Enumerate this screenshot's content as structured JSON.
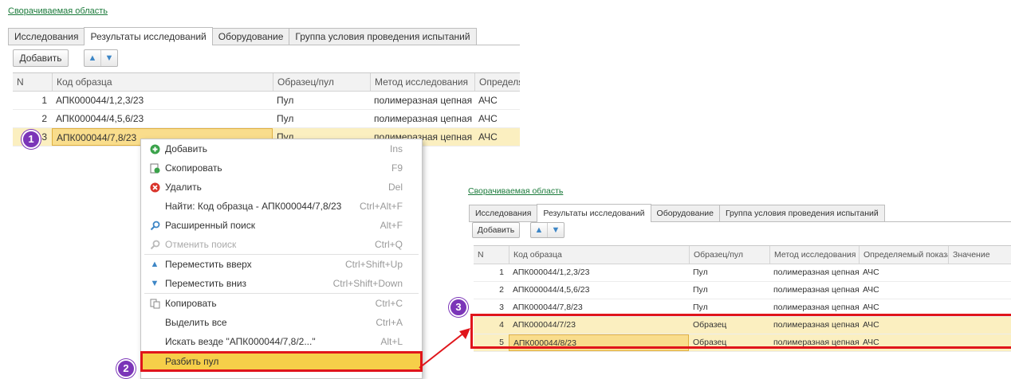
{
  "main": {
    "collapse_link": "Сворачиваемая область",
    "tabs": [
      "Исследования",
      "Результаты исследований",
      "Оборудование",
      "Группа условия проведения испытаний"
    ],
    "add_button": "Добавить",
    "columns": [
      "N",
      "Код образца",
      "Образец/пул",
      "Метод исследования",
      "Определяе"
    ],
    "rows": [
      {
        "n": "1",
        "code": "АПК000044/1,2,3/23",
        "type": "Пул",
        "method": "полимеразная цепная ...",
        "det": "АЧС"
      },
      {
        "n": "2",
        "code": "АПК000044/4,5,6/23",
        "type": "Пул",
        "method": "полимеразная цепная ...",
        "det": "АЧС"
      },
      {
        "n": "3",
        "code": "АПК000044/7,8/23",
        "type": "Пул",
        "method": "полимеразная цепная ...",
        "det": "АЧС"
      }
    ]
  },
  "context_menu": {
    "items": [
      {
        "label": "Добавить",
        "shortcut": "Ins",
        "icon": "add-icon"
      },
      {
        "label": "Скопировать",
        "shortcut": "F9",
        "icon": "copy-icon"
      },
      {
        "label": "Удалить",
        "shortcut": "Del",
        "icon": "delete-icon"
      },
      {
        "label": "Найти: Код образца - АПК000044/7,8/23",
        "shortcut": "Ctrl+Alt+F"
      },
      {
        "label": "Расширенный поиск",
        "shortcut": "Alt+F",
        "icon": "search-icon"
      },
      {
        "label": "Отменить поиск",
        "shortcut": "Ctrl+Q",
        "icon": "cancel-search-icon"
      },
      {
        "label": "Переместить вверх",
        "shortcut": "Ctrl+Shift+Up",
        "icon": "arrow-up-icon"
      },
      {
        "label": "Переместить вниз",
        "shortcut": "Ctrl+Shift+Down",
        "icon": "arrow-down-icon"
      },
      {
        "label": "Копировать",
        "shortcut": "Ctrl+C",
        "icon": "clipboard-icon"
      },
      {
        "label": "Выделить все",
        "shortcut": "Ctrl+A"
      },
      {
        "label": "Искать везде \"АПК000044/7,8/2...\"",
        "shortcut": "Alt+L"
      },
      {
        "label": "Разбить пул",
        "shortcut": ""
      }
    ]
  },
  "result": {
    "collapse_link": "Сворачиваемая область",
    "tabs": [
      "Исследования",
      "Результаты исследований",
      "Оборудование",
      "Группа условия проведения испытаний"
    ],
    "add_button": "Добавить",
    "columns": [
      "N",
      "Код образца",
      "Образец/пул",
      "Метод исследования",
      "Определяемый показа...",
      "Значение"
    ],
    "rows": [
      {
        "n": "1",
        "code": "АПК000044/1,2,3/23",
        "type": "Пул",
        "method": "полимеразная цепная ...",
        "det": "АЧС"
      },
      {
        "n": "2",
        "code": "АПК000044/4,5,6/23",
        "type": "Пул",
        "method": "полимеразная цепная ...",
        "det": "АЧС"
      },
      {
        "n": "3",
        "code": "АПК000044/7,8/23",
        "type": "Пул",
        "method": "полимеразная цепная ...",
        "det": "АЧС"
      },
      {
        "n": "4",
        "code": "АПК000044/7/23",
        "type": "Образец",
        "method": "полимеразная цепная ...",
        "det": "АЧС"
      },
      {
        "n": "5",
        "code": "АПК000044/8/23",
        "type": "Образец",
        "method": "полимеразная цепная ...",
        "det": "АЧС"
      }
    ]
  },
  "badges": [
    "1",
    "2",
    "3"
  ],
  "colors": {
    "badge": "#7b35b8",
    "callout": "#e0151b",
    "selection": "#fbefc0",
    "menu_highlight": "#f6cf49"
  }
}
